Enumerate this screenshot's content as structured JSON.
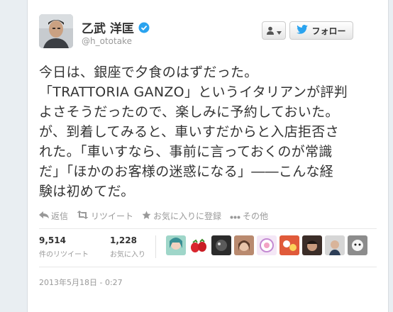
{
  "user": {
    "display_name": "乙武 洋匡",
    "handle": "@h_ototake",
    "verified": true
  },
  "buttons": {
    "follow_label": "フォロー"
  },
  "tweet": {
    "text": "今日は、銀座で夕食のはずだった。\n「TRATTORIA GANZO」というイタリアンが評判\nよさそうだったので、楽しみに予約しておいた。\nが、到着してみると、車いすだからと入店拒否さ\nれた。「車いすなら、事前に言っておくのが常識\nだ」「ほかのお客様の迷惑になる」――こんな経\n験は初めてだ。"
  },
  "actions": [
    {
      "label": "返信",
      "icon": "reply-icon"
    },
    {
      "label": "リツイート",
      "icon": "retweet-icon"
    },
    {
      "label": "お気に入りに登録",
      "icon": "star-icon"
    },
    {
      "label": "その他",
      "icon": "more-icon"
    }
  ],
  "stats": {
    "retweets": {
      "count": "9,514",
      "label": "件のリツイート"
    },
    "favorites": {
      "count": "1,228",
      "label": "お気に入り"
    }
  },
  "timestamp": "2013年5月18日 - 0:27",
  "colors": {
    "accent_blue": "#1da1f2",
    "verified_blue": "#2aa3ef",
    "muted_text": "#999999",
    "page_background": "#e9eef2"
  }
}
